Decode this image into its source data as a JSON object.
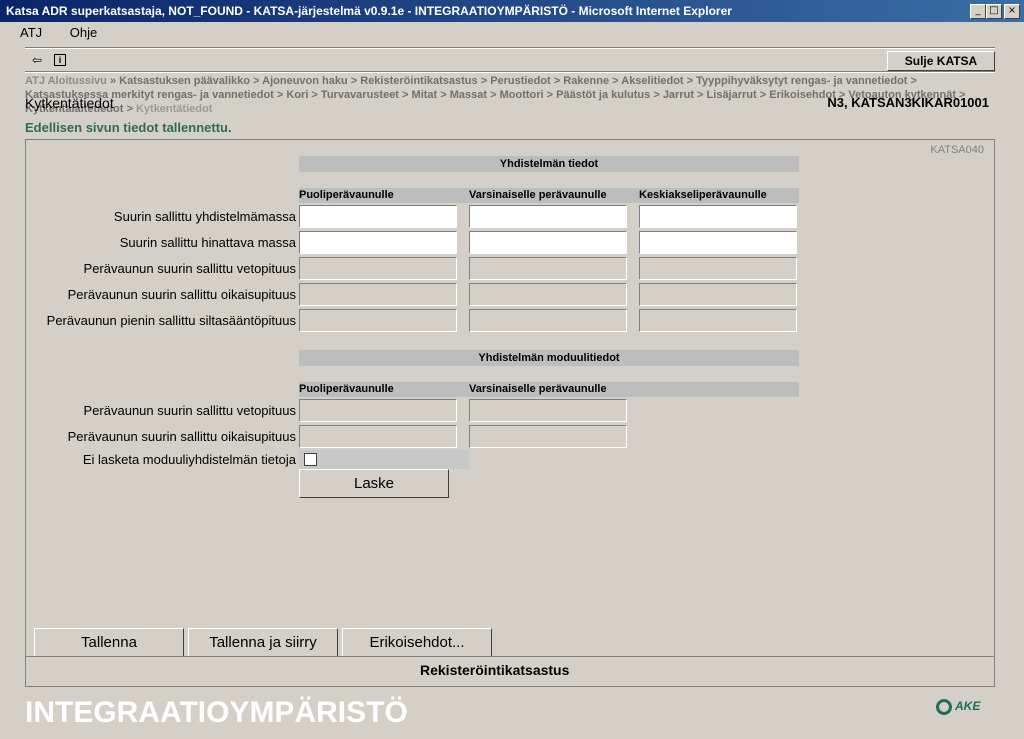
{
  "window": {
    "title": "Katsa ADR superkatsastaja, NOT_FOUND - KATSA-järjestelmä v0.9.1e - INTEGRAATIOYMPÄRISTÖ - Microsoft Internet Explorer",
    "minimize": "_",
    "maximize": "□",
    "close": "×"
  },
  "menu": [
    "ATJ",
    "Ohje"
  ],
  "toolbar": {
    "back_icon": "⇦",
    "info_icon": "i",
    "close_katsa": "Sulje KATSA"
  },
  "breadcrumb": {
    "first": "ATJ Aloitussivu",
    "items": [
      "Katsastuksen päävalikko",
      "Ajoneuvon haku",
      "Rekisteröintikatsastus",
      "Perustiedot",
      "Rakenne",
      "Akselitiedot",
      "Tyyppihyväksytyt rengas- ja vannetiedot",
      "Katsastuksessa merkityt rengas- ja vannetiedot",
      "Kori",
      "Turvavarusteet",
      "Mitat",
      "Massat",
      "Moottori",
      "Päästöt ja kulutus",
      "Jarrut",
      "Lisäjarrut",
      "Erikoisehdot",
      "Vetoauton kytkennät",
      "Kytkentälaitetiedot"
    ],
    "current": "Kytkentätiedot"
  },
  "page": {
    "title": "Kytkentätiedot",
    "identifier": "N3, KATSAN3KIKAR01001",
    "saved_message": "Edellisen sivun tiedot tallennettu.",
    "screen_code": "KATSA040"
  },
  "combination": {
    "header": "Yhdistelmän tiedot",
    "columns": [
      "Puoliperävaunulle",
      "Varsinaiselle perävaunulle",
      "Keskiakseliperävaunulle"
    ],
    "rows": [
      {
        "label": "Suurin sallittu yhdistelmämassa",
        "values": [
          "",
          "",
          ""
        ]
      },
      {
        "label": "Suurin sallittu hinattava massa",
        "values": [
          "",
          "",
          ""
        ]
      },
      {
        "label": "Perävaunun suurin sallittu vetopituus",
        "values": [
          "",
          "",
          ""
        ]
      },
      {
        "label": "Perävaunun suurin sallittu oikaisupituus",
        "values": [
          "",
          "",
          ""
        ]
      },
      {
        "label": "Perävaunun pienin sallittu siltasääntöpituus",
        "values": [
          "",
          "",
          ""
        ]
      }
    ]
  },
  "module": {
    "header": "Yhdistelmän moduulitiedot",
    "columns": [
      "Puoliperävaunulle",
      "Varsinaiselle perävaunulle"
    ],
    "rows": [
      {
        "label": "Perävaunun suurin sallittu vetopituus",
        "values": [
          "",
          ""
        ]
      },
      {
        "label": "Perävaunun suurin sallittu oikaisupituus",
        "values": [
          "",
          ""
        ]
      }
    ],
    "checkbox_label": "Ei lasketa moduuliyhdistelmän tietoja",
    "checkbox_checked": false,
    "calculate": "Laske"
  },
  "actions": {
    "save": "Tallenna",
    "save_and_go": "Tallenna ja siirry",
    "special_conditions": "Erikoisehdot..."
  },
  "footer": {
    "section": "Rekisteröintikatsastus",
    "environment": "INTEGRAATIOYMPÄRISTÖ",
    "logo_text": "AKE"
  },
  "colors": {
    "titlebar": "#0a246a",
    "saved_message": "#2e6b55",
    "logo": "#1f6e5d",
    "section_header": "#bdbdbd"
  }
}
